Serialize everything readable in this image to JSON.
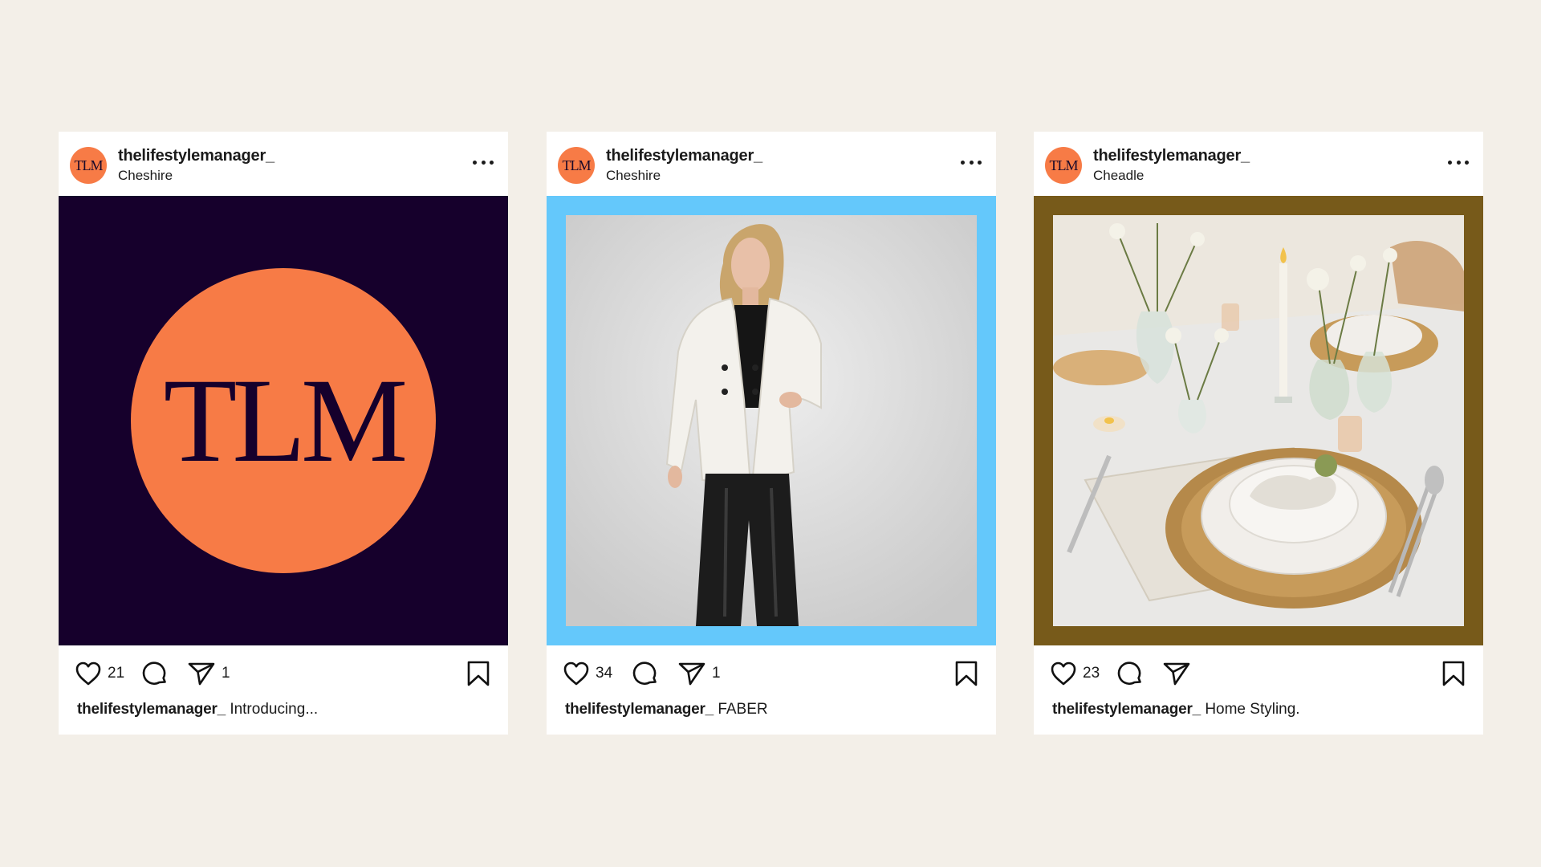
{
  "posts": [
    {
      "avatar_text": "TLM",
      "username": "thelifestylemanager_",
      "location": "Cheshire",
      "image": {
        "kind": "logo",
        "text": "TLM",
        "background": "#16002c",
        "accent": "#f77b46"
      },
      "likes": "21",
      "shares": "1",
      "caption_user": "thelifestylemanager_",
      "caption_text": "Introducing..."
    },
    {
      "avatar_text": "TLM",
      "username": "thelifestylemanager_",
      "location": "Cheshire",
      "image": {
        "kind": "photo-portrait",
        "frame_color": "#64c8fb"
      },
      "likes": "34",
      "shares": "1",
      "caption_user": "thelifestylemanager_",
      "caption_text": "FABER"
    },
    {
      "avatar_text": "TLM",
      "username": "thelifestylemanager_",
      "location": "Cheadle",
      "image": {
        "kind": "photo-table-setting",
        "frame_color": "#775a1a"
      },
      "likes": "23",
      "shares": "",
      "caption_user": "thelifestylemanager_",
      "caption_text": "Home Styling."
    }
  ],
  "icons": {
    "like": "heart-icon",
    "comment": "comment-icon",
    "share": "send-icon",
    "save": "bookmark-icon",
    "more": "more-options-icon"
  }
}
